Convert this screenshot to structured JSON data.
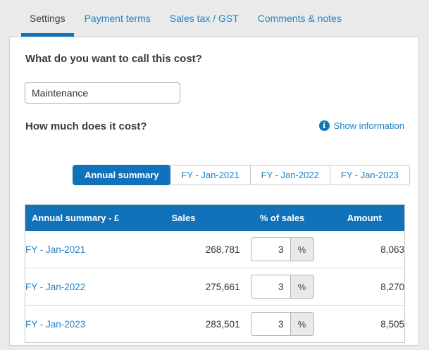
{
  "tabs": {
    "items": [
      {
        "label": "Settings",
        "active": true
      },
      {
        "label": "Payment terms",
        "active": false
      },
      {
        "label": "Sales tax / GST",
        "active": false
      },
      {
        "label": "Comments & notes",
        "active": false
      }
    ]
  },
  "cost_name": {
    "question": "What do you want to call this cost?",
    "value": "Maintenance"
  },
  "cost_amount": {
    "question": "How much does it cost?",
    "info_icon_glyph": "i",
    "show_information_label": "Show information"
  },
  "period_tabs": {
    "items": [
      {
        "label": "Annual summary",
        "active": true
      },
      {
        "label": "FY - Jan-2021",
        "active": false
      },
      {
        "label": "FY - Jan-2022",
        "active": false
      },
      {
        "label": "FY - Jan-2023",
        "active": false
      }
    ]
  },
  "cost_table": {
    "headers": [
      "Annual summary - £",
      "Sales",
      "% of sales",
      "Amount"
    ],
    "percent_suffix": "%",
    "rows": [
      {
        "period": "FY - Jan-2021",
        "sales": "268,781",
        "percent_of_sales": "3",
        "amount": "8,063"
      },
      {
        "period": "FY - Jan-2022",
        "sales": "275,661",
        "percent_of_sales": "3",
        "amount": "8,270"
      },
      {
        "period": "FY - Jan-2023",
        "sales": "283,501",
        "percent_of_sales": "3",
        "amount": "8,505"
      }
    ]
  },
  "colors": {
    "brand_blue": "#1172ba",
    "link_blue": "#2283c5",
    "page_background": "#eaeaea"
  }
}
